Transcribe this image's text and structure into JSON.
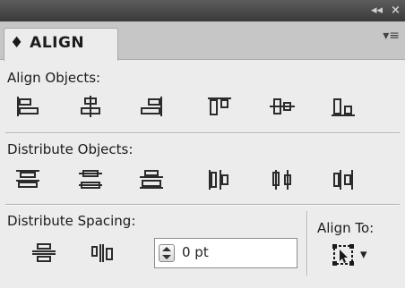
{
  "window": {
    "collapse_glyph": "◂◂",
    "close_glyph": "×"
  },
  "panel": {
    "tab_label": "♦ ALIGN",
    "menu_glyph": "▾≡"
  },
  "align_objects": {
    "label": "Align Objects:",
    "icons": [
      "align-left-edges-icon",
      "align-horizontal-centers-icon",
      "align-right-edges-icon",
      "align-top-edges-icon",
      "align-vertical-centers-icon",
      "align-bottom-edges-icon"
    ]
  },
  "distribute_objects": {
    "label": "Distribute Objects:",
    "icons": [
      "distribute-top-edges-icon",
      "distribute-vertical-centers-icon",
      "distribute-bottom-edges-icon",
      "distribute-left-edges-icon",
      "distribute-horizontal-centers-icon",
      "distribute-right-edges-icon"
    ]
  },
  "distribute_spacing": {
    "label": "Distribute Spacing:",
    "icons": [
      "distribute-vertical-space-icon",
      "distribute-horizontal-space-icon"
    ],
    "value": "0 pt"
  },
  "align_to": {
    "label": "Align To:",
    "icon": "align-to-selection-icon",
    "dropdown_glyph": "▾"
  },
  "colors": {
    "panel_bg": "#ececec",
    "titlebar": "#3f3f3f",
    "icon_stroke": "#2b2b2b"
  }
}
